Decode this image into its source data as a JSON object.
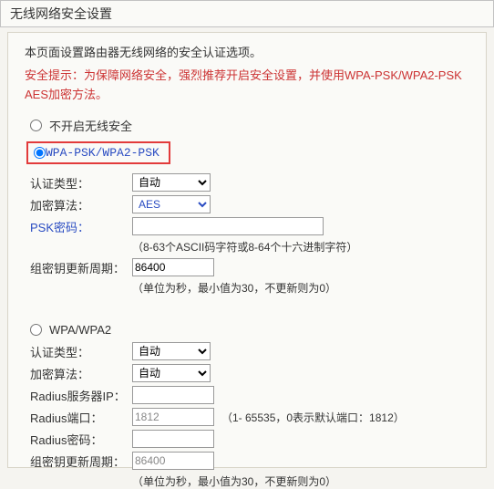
{
  "title": "无线网络安全设置",
  "intro": "本页面设置路由器无线网络的安全认证选项。",
  "warning": "安全提示：为保障网络安全，强烈推荐开启安全设置，并使用WPA-PSK/WPA2-PSK AES加密方法。",
  "options": {
    "none": {
      "label": "不开启无线安全",
      "checked": false
    },
    "wpapsk": {
      "label": "WPA-PSK/WPA2-PSK",
      "checked": true
    },
    "wpa": {
      "label": "WPA/WPA2",
      "checked": false
    }
  },
  "wpapsk": {
    "auth_label": "认证类型：",
    "auth_value": "自动",
    "cipher_label": "加密算法：",
    "cipher_value": "AES",
    "psk_label": "PSK密码：",
    "psk_value": "",
    "psk_hint": "（8-63个ASCII码字符或8-64个十六进制字符）",
    "rekey_label": "组密钥更新周期：",
    "rekey_value": "86400",
    "rekey_hint": "（单位为秒，最小值为30，不更新则为0）"
  },
  "wpa": {
    "auth_label": "认证类型：",
    "auth_value": "自动",
    "cipher_label": "加密算法：",
    "cipher_value": "自动",
    "radius_ip_label": "Radius服务器IP：",
    "radius_ip_value": "",
    "radius_port_label": "Radius端口：",
    "radius_port_value": "1812",
    "radius_port_hint": "（1- 65535，0表示默认端口：1812）",
    "radius_pw_label": "Radius密码：",
    "radius_pw_value": "",
    "rekey_label": "组密钥更新周期：",
    "rekey_value": "86400",
    "rekey_hint": "（单位为秒，最小值为30，不更新则为0）"
  }
}
